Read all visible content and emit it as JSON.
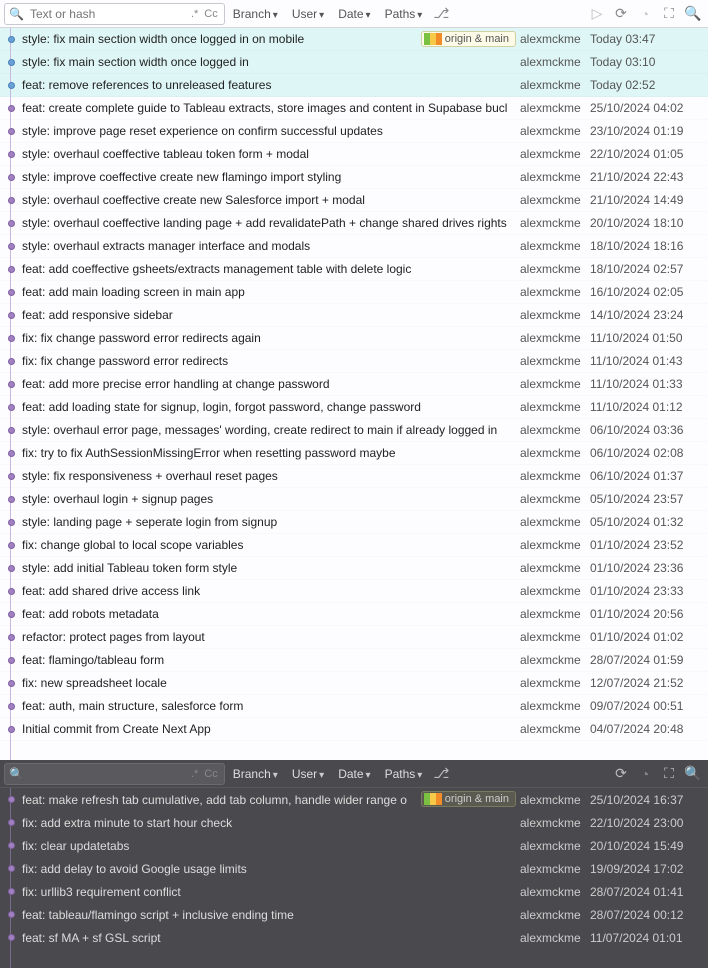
{
  "top_toolbar": {
    "search_placeholder": "Text or hash",
    "cc_label": "Cc",
    "filters": {
      "branch": "Branch",
      "user": "User",
      "date": "Date",
      "paths": "Paths"
    }
  },
  "bottom_toolbar": {
    "search_placeholder": "",
    "cc_label": "Cc",
    "filters": {
      "branch": "Branch",
      "user": "User",
      "date": "Date",
      "paths": "Paths"
    }
  },
  "badge_label": "origin & main",
  "top_commits": [
    {
      "msg": "style: fix main section width once logged in on mobile",
      "author": "alexmckme",
      "date": "Today 03:47",
      "badge": true,
      "sel": true
    },
    {
      "msg": "style: fix main section width once logged in",
      "author": "alexmckme",
      "date": "Today 03:10",
      "sel": true
    },
    {
      "msg": "feat: remove references to unreleased features",
      "author": "alexmckme",
      "date": "Today 02:52",
      "sel": true
    },
    {
      "msg": "feat: create complete guide to Tableau extracts, store images and content in Supabase bucl",
      "author": "alexmckme",
      "date": "25/10/2024 04:02"
    },
    {
      "msg": "style: improve page reset experience on confirm successful updates",
      "author": "alexmckme",
      "date": "23/10/2024 01:19"
    },
    {
      "msg": "style: overhaul coeffective tableau token form + modal",
      "author": "alexmckme",
      "date": "22/10/2024 01:05"
    },
    {
      "msg": "style: improve coeffective create new flamingo import styling",
      "author": "alexmckme",
      "date": "21/10/2024 22:43"
    },
    {
      "msg": "style: overhaul coeffective create new Salesforce import + modal",
      "author": "alexmckme",
      "date": "21/10/2024 14:49"
    },
    {
      "msg": "style: overhaul coeffective landing page + add revalidatePath + change shared drives rights",
      "author": "alexmckme",
      "date": "20/10/2024 18:10"
    },
    {
      "msg": "style: overhaul extracts manager interface and modals",
      "author": "alexmckme",
      "date": "18/10/2024 18:16"
    },
    {
      "msg": "feat: add coeffective gsheets/extracts management table with delete logic",
      "author": "alexmckme",
      "date": "18/10/2024 02:57"
    },
    {
      "msg": "feat: add main loading screen in main app",
      "author": "alexmckme",
      "date": "16/10/2024 02:05"
    },
    {
      "msg": "feat: add responsive sidebar",
      "author": "alexmckme",
      "date": "14/10/2024 23:24"
    },
    {
      "msg": "fix: fix change password error redirects again",
      "author": "alexmckme",
      "date": "11/10/2024 01:50"
    },
    {
      "msg": "fix: fix change password error redirects",
      "author": "alexmckme",
      "date": "11/10/2024 01:43"
    },
    {
      "msg": "feat: add more precise error handling at change password",
      "author": "alexmckme",
      "date": "11/10/2024 01:33"
    },
    {
      "msg": "feat: add loading state for signup, login, forgot password, change password",
      "author": "alexmckme",
      "date": "11/10/2024 01:12"
    },
    {
      "msg": "style: overhaul error page, messages' wording, create redirect to main if already logged in",
      "author": "alexmckme",
      "date": "06/10/2024 03:36"
    },
    {
      "msg": "fix: try to fix AuthSessionMissingError when resetting password maybe",
      "author": "alexmckme",
      "date": "06/10/2024 02:08"
    },
    {
      "msg": "style: fix responsiveness + overhaul reset pages",
      "author": "alexmckme",
      "date": "06/10/2024 01:37"
    },
    {
      "msg": "style: overhaul login + signup pages",
      "author": "alexmckme",
      "date": "05/10/2024 23:57"
    },
    {
      "msg": "style: landing page + seperate login from signup",
      "author": "alexmckme",
      "date": "05/10/2024 01:32"
    },
    {
      "msg": "fix: change global to local scope variables",
      "author": "alexmckme",
      "date": "01/10/2024 23:52"
    },
    {
      "msg": "style: add initial Tableau token form style",
      "author": "alexmckme",
      "date": "01/10/2024 23:36"
    },
    {
      "msg": "feat: add shared drive access link",
      "author": "alexmckme",
      "date": "01/10/2024 23:33"
    },
    {
      "msg": "feat: add robots metadata",
      "author": "alexmckme",
      "date": "01/10/2024 20:56"
    },
    {
      "msg": "refactor: protect pages from layout",
      "author": "alexmckme",
      "date": "01/10/2024 01:02"
    },
    {
      "msg": "feat: flamingo/tableau form",
      "author": "alexmckme",
      "date": "28/07/2024 01:59"
    },
    {
      "msg": "fix: new spreadsheet locale",
      "author": "alexmckme",
      "date": "12/07/2024 21:52"
    },
    {
      "msg": "feat: auth, main structure, salesforce form",
      "author": "alexmckme",
      "date": "09/07/2024 00:51"
    },
    {
      "msg": "Initial commit from Create Next App",
      "author": "alexmckme",
      "date": "04/07/2024 20:48"
    }
  ],
  "bottom_commits": [
    {
      "msg": "feat: make refresh tab cumulative, add tab column, handle wider range o",
      "author": "alexmckme",
      "date": "25/10/2024 16:37",
      "badge": true
    },
    {
      "msg": "fix: add extra minute to start hour check",
      "author": "alexmckme",
      "date": "22/10/2024 23:00"
    },
    {
      "msg": "fix: clear updatetabs",
      "author": "alexmckme",
      "date": "20/10/2024 15:49"
    },
    {
      "msg": "fix: add delay to avoid Google usage limits",
      "author": "alexmckme",
      "date": "19/09/2024 17:02"
    },
    {
      "msg": "fix: urllib3 requirement conflict",
      "author": "alexmckme",
      "date": "28/07/2024 01:41"
    },
    {
      "msg": "feat: tableau/flamingo script + inclusive ending time",
      "author": "alexmckme",
      "date": "28/07/2024 00:12"
    },
    {
      "msg": "feat: sf MA + sf GSL script",
      "author": "alexmckme",
      "date": "11/07/2024 01:01"
    }
  ]
}
